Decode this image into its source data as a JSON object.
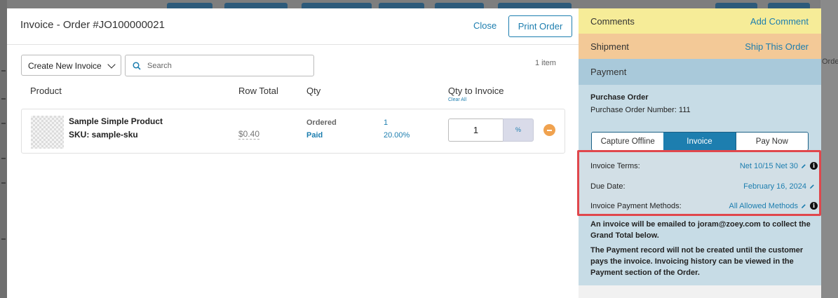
{
  "modal": {
    "title": "Invoice - Order #JO100000021",
    "close_label": "Close",
    "print_label": "Print Order",
    "invoice_select": "Create New Invoice",
    "search_placeholder": "Search",
    "item_count": "1 item",
    "columns": {
      "product": "Product",
      "row_total": "Row Total",
      "qty": "Qty",
      "qty_to_invoice": "Qty to Invoice",
      "clear_all": "Clear All"
    },
    "row": {
      "name": "Sample Simple Product",
      "sku": "SKU: sample-sku",
      "row_total": "$0.40",
      "ordered_label": "Ordered",
      "paid_label": "Paid",
      "ordered_value": "1",
      "paid_value": "20.00%",
      "qty_input": "1",
      "percent_label": "%"
    }
  },
  "panel": {
    "comments": {
      "title": "Comments",
      "action": "Add Comment",
      "color": "#f6ec98"
    },
    "shipment": {
      "title": "Shipment",
      "action": "Ship This Order",
      "color": "#f3c997"
    },
    "payment": {
      "title": "Payment",
      "color": "#a9c9da"
    },
    "po_title": "Purchase Order",
    "po_number": "Purchase Order Number: 111",
    "tabs": [
      "Capture Offline",
      "Invoice",
      "Pay Now"
    ],
    "active_tab": "Invoice",
    "terms": [
      {
        "label": "Invoice Terms:",
        "value": "Net 10/15 Net 30",
        "info": true
      },
      {
        "label": "Due Date:",
        "value": "February 16, 2024",
        "info": false
      },
      {
        "label": "Invoice Payment Methods:",
        "value": "All Allowed Methods",
        "info": true
      }
    ],
    "note1": "An invoice will be emailed to joram@zoey.com to collect the Grand Total below.",
    "note2": "The Payment record will not be created until the customer pays the invoice. Invoicing history can be viewed in the Payment section of the Order."
  },
  "background": {
    "right_fragment": "Orde"
  },
  "colors": {
    "accent": "#1d7eaf",
    "highlight_border": "#e0474c",
    "remove": "#f0a24f"
  }
}
